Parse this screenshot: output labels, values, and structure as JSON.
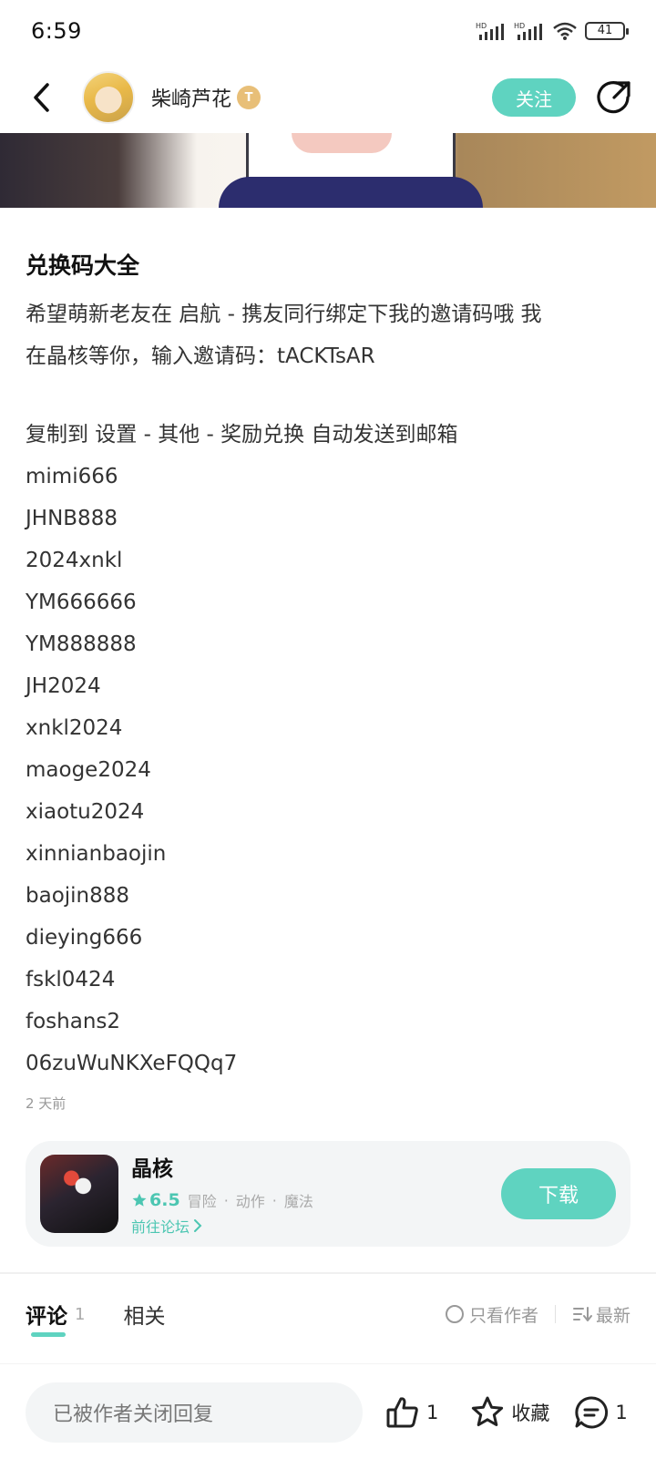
{
  "status_bar": {
    "time": "6:59",
    "battery": "41"
  },
  "header": {
    "username": "柴崎芦花",
    "level_badge": "T",
    "follow_label": "关注"
  },
  "post": {
    "title": "兑换码大全",
    "lines": [
      "希望萌新老友在 启航 - 携友同行绑定下我的邀请码哦 我",
      "在晶核等你，输入邀请码：tACKTsAR",
      "",
      "复制到 设置 - 其他 - 奖励兑换 自动发送到邮箱",
      "mimi666",
      "JHNB888",
      "2024xnkl",
      "YM666666",
      "YM888888",
      "JH2024",
      "xnkl2024",
      "maoge2024",
      "xiaotu2024",
      "xinnianbaojin",
      "baojin888",
      "dieying666",
      "fskl0424",
      "foshans2",
      "06zuWuNKXeFQQq7"
    ],
    "time": "2 天前"
  },
  "game_card": {
    "name": "晶核",
    "rating": "6.5",
    "tags": [
      "冒险",
      "动作",
      "魔法"
    ],
    "separator": "·",
    "forum_link": "前往论坛",
    "download_label": "下载"
  },
  "tabs": {
    "comments_label": "评论",
    "comments_count": "1",
    "related_label": "相关",
    "only_author_label": "只看作者",
    "sort_label": "最新"
  },
  "bottom_bar": {
    "reply_placeholder": "已被作者关闭回复",
    "like_count": "1",
    "favorite_label": "收藏",
    "comment_count": "1"
  },
  "colors": {
    "accent": "#5fd3c0",
    "accent_text": "#4cc6b2",
    "card_bg": "#f3f5f6"
  }
}
